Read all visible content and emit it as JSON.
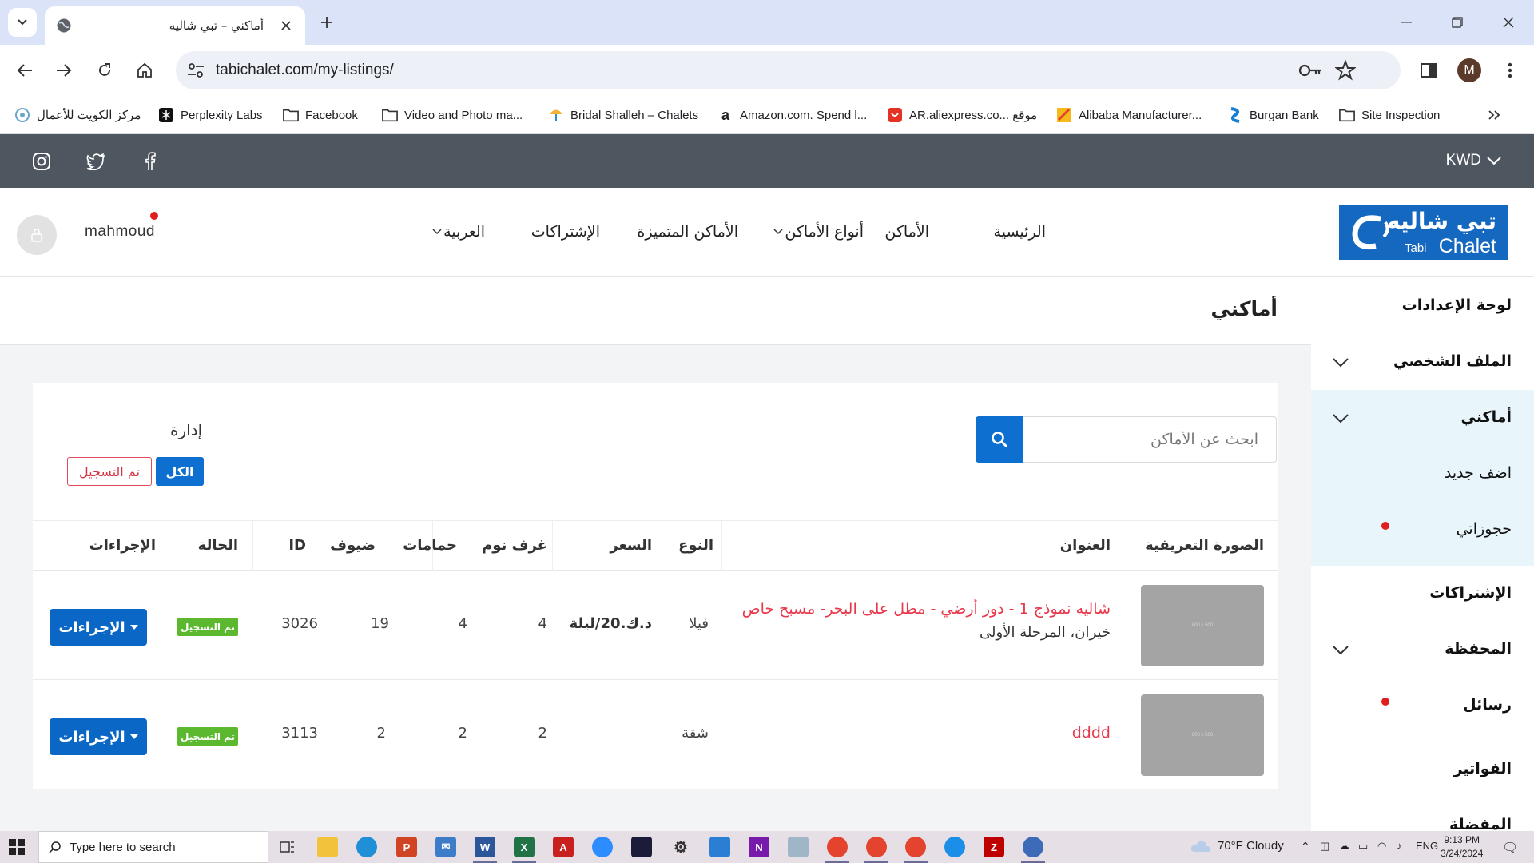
{
  "browser": {
    "tab_title": "أماكني – تبي شاليه",
    "url": "tabichalet.com/my-listings/",
    "profile_initial": "M",
    "bookmarks": [
      {
        "label": "مركز الكويت للأعمال",
        "icon": "kbc-icon"
      },
      {
        "label": "Perplexity Labs",
        "icon": "perplexity-icon"
      },
      {
        "label": "Facebook",
        "icon": "folder-icon"
      },
      {
        "label": "Video and Photo ma...",
        "icon": "folder-icon"
      },
      {
        "label": "Bridal Shalleh – Chalets",
        "icon": "umbrella-icon"
      },
      {
        "label": "Amazon.com. Spend l...",
        "icon": "amazon-icon"
      },
      {
        "label": "AR.aliexpress.co... موقع",
        "icon": "aliexpress-icon"
      },
      {
        "label": "Alibaba Manufacturer...",
        "icon": "alibaba-icon"
      },
      {
        "label": "Burgan Bank",
        "icon": "burgan-icon"
      },
      {
        "label": "Site Inspection",
        "icon": "folder-icon"
      }
    ]
  },
  "site": {
    "currency": "KWD",
    "logo": {
      "arabic": "تبي شاليه",
      "english": "Chalet",
      "tabi": "Tabi"
    },
    "nav": {
      "home": "الرئيسية",
      "places": "الأماكن",
      "place_types": "أنواع الأماكن",
      "featured": "الأماكن المتميزة",
      "subscriptions": "الإشتراكات",
      "language": "العربية"
    },
    "user": {
      "name": "mahmoud"
    }
  },
  "sidebar": {
    "dashboard": "لوحة الإعدادات",
    "profile": "الملف الشخصي",
    "my_places": "أماكني",
    "add_new": "اضف جديد",
    "my_bookings": "حجوزاتي",
    "subscriptions": "الإشتراكات",
    "wallet": "المحفظة",
    "messages": "رسائل",
    "invoices": "الفواتير",
    "favorites": "المفضلة"
  },
  "main": {
    "page_title": "أماكني",
    "search_placeholder": "ابحث عن الأماكن",
    "manage_label": "إدارة",
    "filter_all": "الكل",
    "filter_registered": "تم التسجيل",
    "columns": {
      "image": "الصورة التعريفية",
      "title": "العنوان",
      "type": "النوع",
      "price": "السعر",
      "bedrooms": "غرف نوم",
      "bathrooms": "حمامات",
      "guests": "ضيوف",
      "id": "ID",
      "status": "الحالة",
      "actions": "الإجراءات"
    },
    "rows": [
      {
        "thumb_text": "800 x 500",
        "title": "شاليه نموذج 1 - دور أرضي - مطل على البحر- مسبح خاص",
        "location": "خيران، المرحلة الأولى",
        "type": "فيلا",
        "price": "د.ك.20/ليلة",
        "bedrooms": "4",
        "bathrooms": "4",
        "guests": "19",
        "id": "3026",
        "status": "تم التسجيل",
        "action": "الإجراءات"
      },
      {
        "thumb_text": "800 x 500",
        "title": "dddd",
        "location": "",
        "type": "شقة",
        "price": "",
        "bedrooms": "2",
        "bathrooms": "2",
        "guests": "2",
        "id": "3113",
        "status": "تم التسجيل",
        "action": "الإجراءات"
      }
    ]
  },
  "taskbar": {
    "search_placeholder": "Type here to search",
    "weather": "70°F  Cloudy",
    "language": "ENG",
    "time": "9:13 PM",
    "date": "3/24/2024"
  },
  "colors": {
    "accent_blue": "#0d6fcf",
    "link_red": "#e8384b",
    "status_green": "#5cb82f",
    "topbar": "#4e5660"
  }
}
